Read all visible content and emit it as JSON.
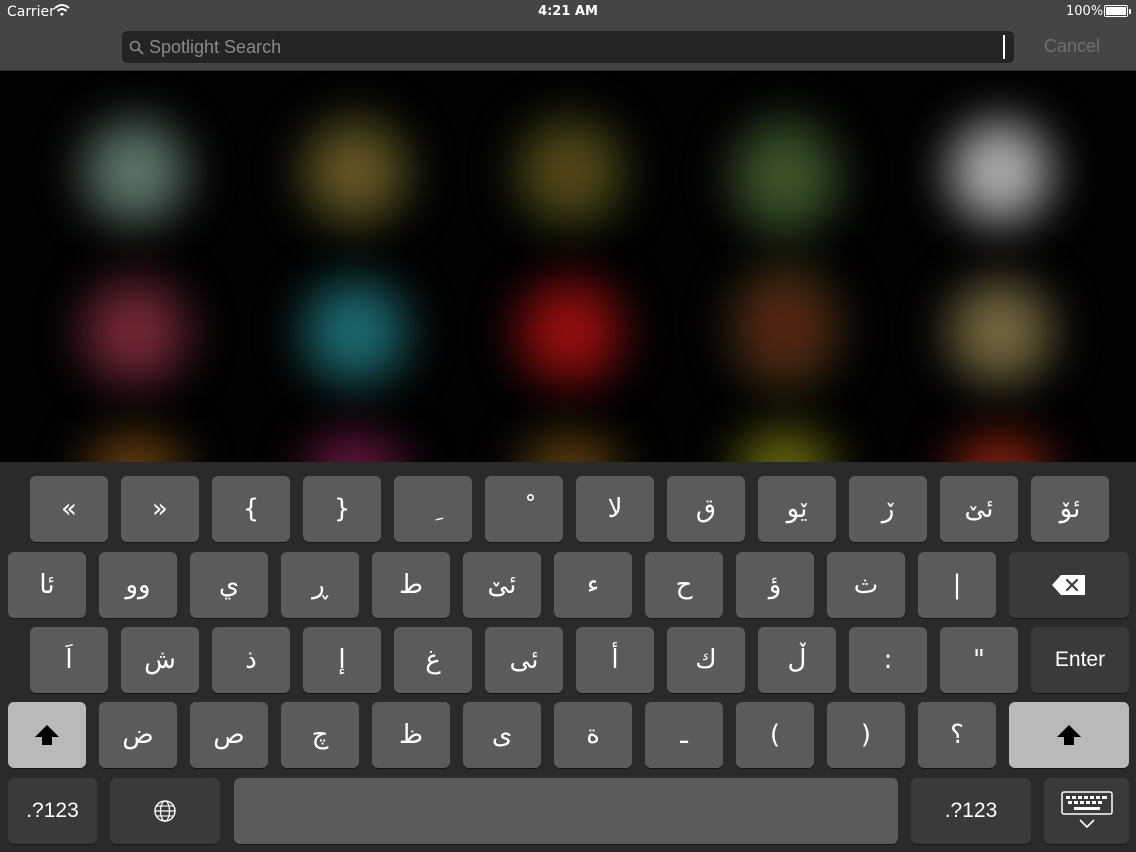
{
  "status_bar": {
    "carrier": "Carrier",
    "time": "4:21 AM",
    "battery_percent": "100%",
    "battery_level": 1.0,
    "icons": [
      "wifi-icon",
      "battery-icon"
    ]
  },
  "search": {
    "placeholder": "Spotlight Search",
    "value": "",
    "cancel_label": "Cancel",
    "icon": "search-icon"
  },
  "keyboard": {
    "row1": [
      "«",
      "»",
      "{",
      "}",
      "ِ",
      "ْ",
      "لا",
      "ق",
      "ێو",
      "ڒ",
      "ئێ",
      "ئۆ"
    ],
    "row2": [
      "ئا",
      "وو",
      "ي",
      "ڕ",
      "ط",
      "ئێ",
      "ء",
      "ح",
      "ؤ",
      "ث",
      "|"
    ],
    "row3": [
      "اَ",
      "ش",
      "ذ",
      "إ",
      "غ",
      "ئى",
      "أ",
      "ك",
      "ڵ",
      ":",
      "\""
    ],
    "row3_enter": "Enter",
    "row4": [
      "ض",
      "ص",
      "چ",
      "ظ",
      "ى",
      "ة",
      "ـ",
      "(",
      ")",
      "؟"
    ],
    "numbers_label": ".?123",
    "icons": {
      "delete": "delete-icon",
      "shift": "shift-icon",
      "globe": "globe-icon",
      "dismiss": "keyboard-dismiss-icon"
    }
  },
  "colors": {
    "status_bar_bg": "#454545",
    "key_bg": "#5b5b5b",
    "dark_key_bg": "#3a3a3a",
    "shift_key_bg": "#b9b9b9",
    "keyboard_bg": "#2a2a2a"
  }
}
